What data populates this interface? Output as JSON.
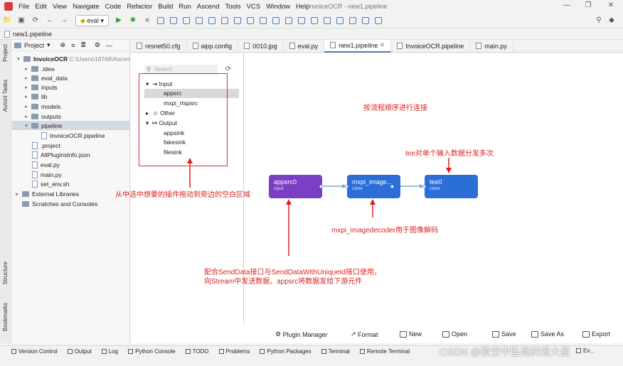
{
  "menu": {
    "items": [
      "File",
      "Edit",
      "View",
      "Navigate",
      "Code",
      "Refactor",
      "Build",
      "Run",
      "Ascend",
      "Tools",
      "VCS",
      "Window",
      "Help"
    ],
    "window_title": "InvoiceOCR - new1.pipeline"
  },
  "toolbar": {
    "run_config": "eval"
  },
  "breadcrumb": {
    "file": "new1.pipeline"
  },
  "left_strip": {
    "project": "Project",
    "autonl": "Autonl Tasks",
    "structure": "Structure",
    "bookmarks": "Bookmarks"
  },
  "project_panel": {
    "header": "Project",
    "root_name": "InvoiceOCR",
    "root_path": "C:\\Users\\18768\\Ascen",
    "items": [
      ".idea",
      "eval_data",
      "inputs",
      "lib",
      "models",
      "outputs",
      "pipeline",
      "InvoiceOCR.pipeline",
      ".project",
      "AllPluginsInfo.json",
      "eval.py",
      "main.py",
      "set_env.sh",
      "External Libraries",
      "Scratches and Consoles"
    ]
  },
  "tabs": [
    "resnet50.cfg",
    "aipp.config",
    "0010.jpg",
    "eval.py",
    "new1.pipeline",
    "InvoiceOCR.pipeline",
    "main.py"
  ],
  "palette": {
    "search_placeholder": "Search",
    "groups": [
      {
        "label": "Input",
        "children": [
          "appsrc",
          "mxpi_rtspsrc"
        ]
      },
      {
        "label": "Other",
        "children": []
      },
      {
        "label": "Output",
        "children": [
          "appsink",
          "fakesink",
          "filesink"
        ]
      }
    ]
  },
  "nodes": [
    {
      "name": "appsrc0",
      "type": "Input",
      "color": "#7b3fc4"
    },
    {
      "name": "mxpi_image...",
      "type": "Other",
      "color": "#2a6ed6"
    },
    {
      "name": "tee0",
      "type": "Other",
      "color": "#2a6ed6"
    }
  ],
  "annotations": {
    "order": "按流程顺序进行连接",
    "tee": "tee对单个输入数据分发多次",
    "drag": "从中选中想要的插件拖动到旁边的空白区域",
    "decoder": "mxpi_imagedecoder用于图像解码",
    "appsrc_line1": "配合SendData接口与SendDataWithUniqueId接口使用，",
    "appsrc_line2": "向Stream中发送数据，appsrc将数据发给下游元件"
  },
  "canvas_buttons": [
    "Plugin Manager",
    "Format",
    "New",
    "Open",
    "Save",
    "Save As",
    "Export"
  ],
  "statusbar": [
    "Version Control",
    "Output",
    "Log",
    "Python Console",
    "TODO",
    "Problems",
    "Python Packages",
    "Terminal",
    "Remote Terminal",
    "Ev..."
  ],
  "watermark": "CSDN @夜空中坠亮的派大星",
  "colors": {
    "accent": "#4a7ec0",
    "annotation": "#e02020"
  }
}
